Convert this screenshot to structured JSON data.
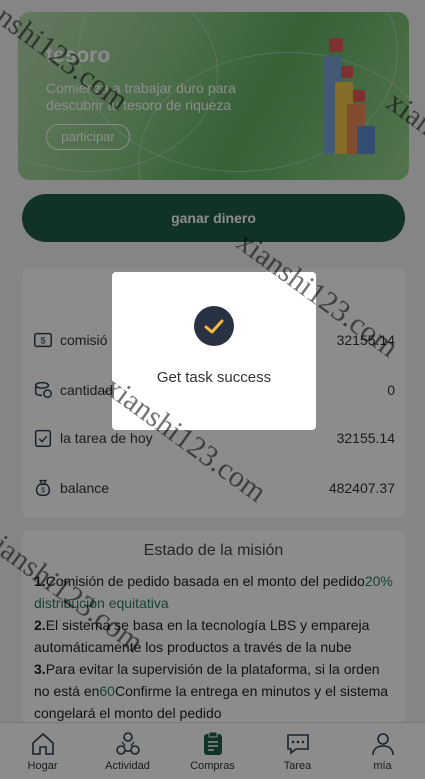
{
  "banner": {
    "title": "tesoro",
    "subtitle": "Comienza a trabajar duro para descubrir tu tesoro de riqueza",
    "button": "participar"
  },
  "earn_button": "ganar dinero",
  "stats": [
    {
      "icon": "commission-icon",
      "label": "comisió",
      "value": "32155.14"
    },
    {
      "icon": "coins-icon",
      "label": "cantidad",
      "value": "0"
    },
    {
      "icon": "clipboard-check-icon",
      "label": "la tarea de hoy",
      "value": "32155.14"
    },
    {
      "icon": "money-bag-icon",
      "label": "balance",
      "value": "482407.37"
    }
  ],
  "mission": {
    "title": "Estado de la misión",
    "p1_num": "1.",
    "p1_a": "Comisión de pedido basada en el monto del pedido",
    "p1_hl": "20% distribución equitativa",
    "p2_num": "2.",
    "p2": "El sistema se basa en la tecnología LBS y empareja automáticamente los productos a través de la nube",
    "p3_num": "3.",
    "p3_a": "Para evitar la supervisión de la plataforma, si la orden no está en",
    "p3_hl": "60",
    "p3_b": "Confirme la entrega en minutos y el sistema congelará el monto del pedido"
  },
  "tabs": [
    {
      "icon": "home-icon",
      "label": "Hogar"
    },
    {
      "icon": "activity-icon",
      "label": "Actividad"
    },
    {
      "icon": "purchases-icon",
      "label": "Compras"
    },
    {
      "icon": "chat-icon",
      "label": "Tarea"
    },
    {
      "icon": "user-icon",
      "label": "mía"
    }
  ],
  "modal": {
    "icon": "check-icon",
    "message": "Get task success"
  },
  "watermark": "xianshi123.com",
  "colors": {
    "primary": "#1f5d47",
    "accent": "#2a7a5c",
    "modal_icon": "#283243",
    "check": "#f5b942"
  }
}
